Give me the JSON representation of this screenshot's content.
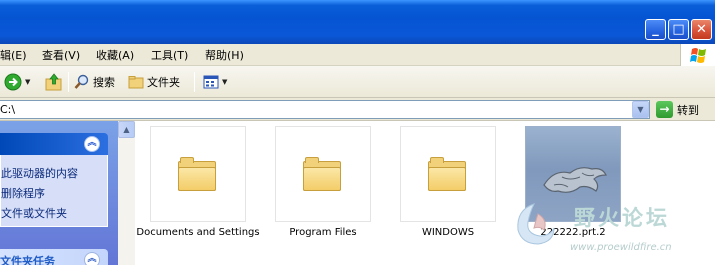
{
  "menu": {
    "items": [
      "辑(E)",
      "查看(V)",
      "收藏(A)",
      "工具(T)",
      "帮助(H)"
    ]
  },
  "caption_buttons": {
    "minimize": "_",
    "maximize": "□",
    "close": "✕"
  },
  "toolbar": {
    "search_label": "搜索",
    "folders_label": "文件夹"
  },
  "address": {
    "value": "C:\\",
    "go_label": "转到"
  },
  "task_pane": {
    "section1_links": [
      "此驱动器的内容",
      "删除程序",
      "文件或文件夹"
    ],
    "section2_title": "文件夹任务"
  },
  "files": [
    {
      "name": "Documents and Settings",
      "type": "folder"
    },
    {
      "name": "Program Files",
      "type": "folder"
    },
    {
      "name": "WINDOWS",
      "type": "folder"
    },
    {
      "name": "222222.prt.2",
      "type": "file"
    }
  ],
  "watermark": {
    "title": "野火论坛",
    "url": "www.proewildfire.cn"
  },
  "colors": {
    "titlebar": "#0554d2",
    "taskpane": "#7ba2e7",
    "watermark": "#bcd8d6"
  }
}
